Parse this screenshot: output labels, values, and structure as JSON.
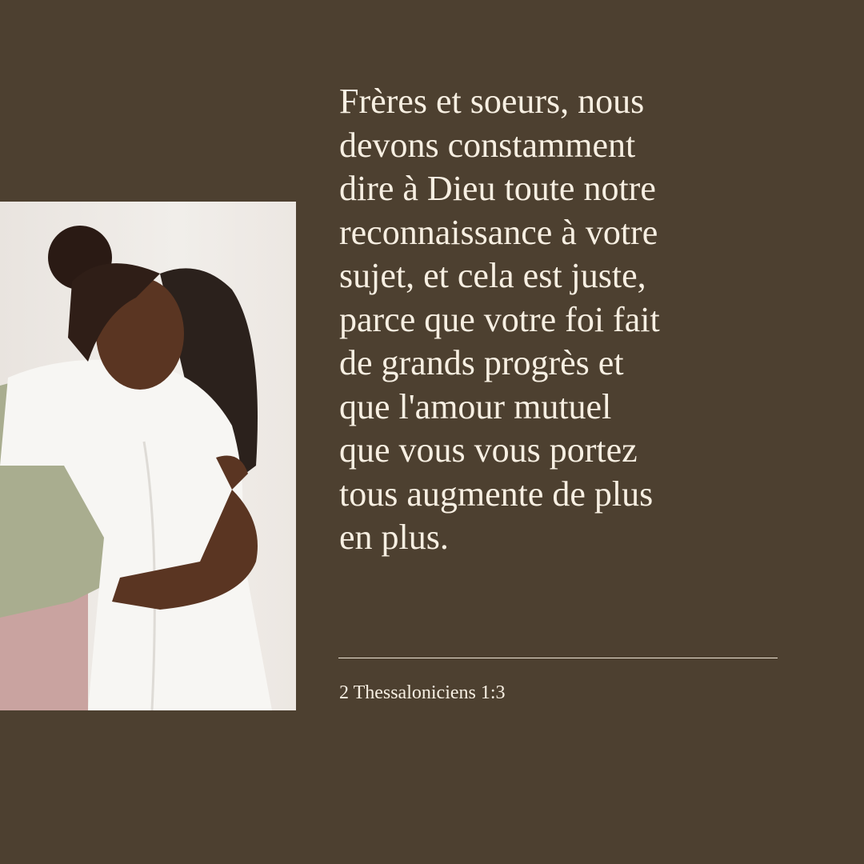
{
  "verse_lines": [
    " Frères et soeurs, nous",
    "devons constamment",
    "dire à Dieu toute notre",
    "reconnaissance à votre",
    "sujet, et cela est juste,",
    "parce que votre foi fait",
    "de grands progrès et",
    "que l'amour mutuel",
    "que vous vous portez",
    "tous augmente de plus",
    "en plus."
  ],
  "reference": "2 Thessaloniciens 1:3",
  "colors": {
    "background": "#4d4030",
    "text": "#f7efe2"
  }
}
